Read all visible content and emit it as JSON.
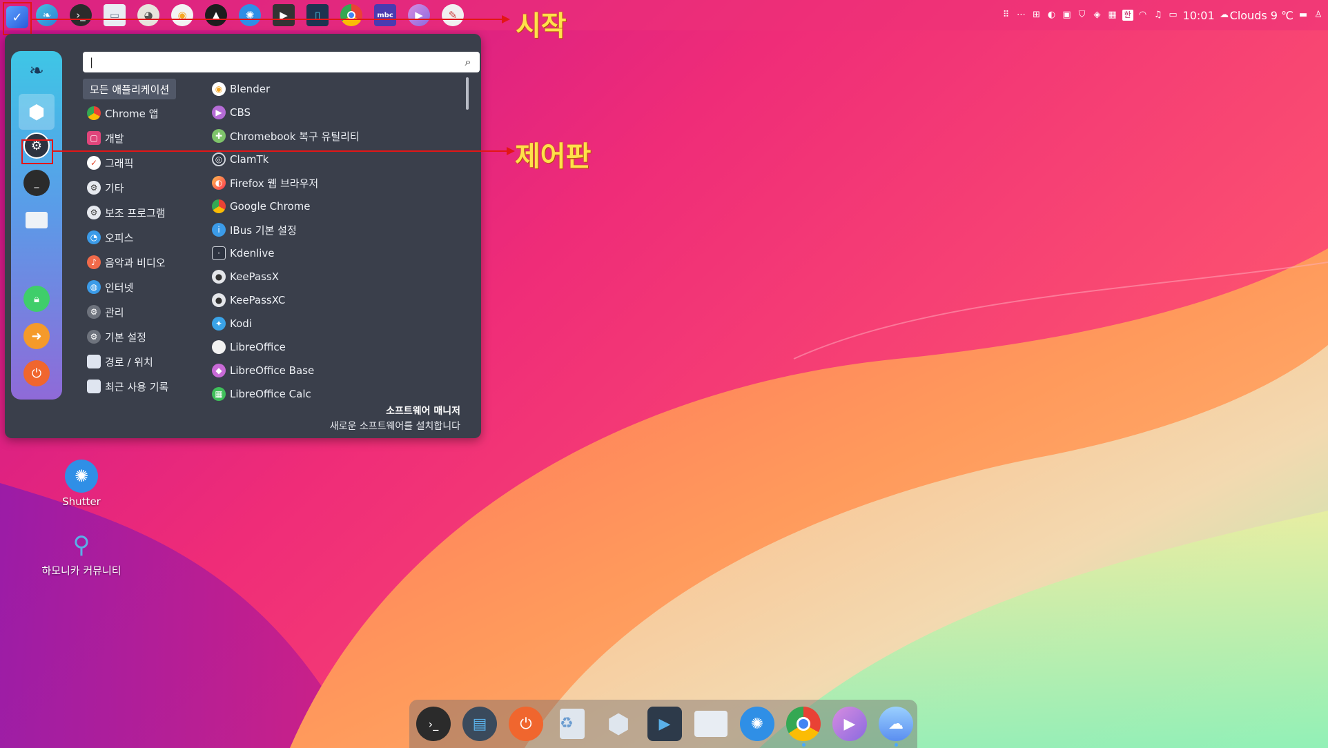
{
  "panel": {
    "launchers": [
      {
        "name": "start-menu",
        "icon": "start-icon"
      },
      {
        "name": "hamonikr-browser",
        "icon": "hamonikr-icon"
      },
      {
        "name": "terminal",
        "icon": "terminal-icon"
      },
      {
        "name": "file-manager",
        "icon": "folder-icon"
      },
      {
        "name": "gimp",
        "icon": "gimp-icon"
      },
      {
        "name": "blender",
        "icon": "blender-icon"
      },
      {
        "name": "inkscape",
        "icon": "inkscape-icon"
      },
      {
        "name": "shutter",
        "icon": "shutter-icon"
      },
      {
        "name": "kdenlive",
        "icon": "kdenlive-icon"
      },
      {
        "name": "libreoffice-writer",
        "icon": "document-icon"
      },
      {
        "name": "google-chrome",
        "icon": "chrome-icon"
      },
      {
        "name": "mbc-radio",
        "icon": "mbc-icon"
      },
      {
        "name": "cbs-player",
        "icon": "play-icon"
      },
      {
        "name": "text-editor",
        "icon": "pencil-icon"
      }
    ],
    "tray": {
      "time": "10:01",
      "weather": "Clouds 9 ℃",
      "ime": "한"
    }
  },
  "annotations": {
    "start_label": "시작",
    "control_panel_label": "제어판"
  },
  "menu": {
    "search": {
      "value": "|",
      "placeholder": ""
    },
    "sidebar": [
      {
        "name": "hamonikr",
        "icon": "hamonikr-icon"
      },
      {
        "name": "software-manager",
        "icon": "package-icon"
      },
      {
        "name": "control-panel",
        "icon": "settings-icon"
      },
      {
        "name": "terminal",
        "icon": "terminal-icon"
      },
      {
        "name": "files",
        "icon": "folder-icon"
      },
      {
        "name": "lock-screen",
        "icon": "lock-icon"
      },
      {
        "name": "logout",
        "icon": "logout-icon"
      },
      {
        "name": "shutdown",
        "icon": "power-icon"
      }
    ],
    "categories": [
      {
        "label": "모든 애플리케이션",
        "icon": "none",
        "color": ""
      },
      {
        "label": "Chrome 앱",
        "icon": "chrome-icon",
        "color": "#e94235"
      },
      {
        "label": "개발",
        "icon": "code-icon",
        "color": "#e0457b"
      },
      {
        "label": "그래픽",
        "icon": "graphics-icon",
        "color": "#ffffff"
      },
      {
        "label": "기타",
        "icon": "gear-icon",
        "color": "#d0d4dc"
      },
      {
        "label": "보조 프로그램",
        "icon": "gear-icon",
        "color": "#d0d4dc"
      },
      {
        "label": "오피스",
        "icon": "office-icon",
        "color": "#3b9be8"
      },
      {
        "label": "음악과 비디오",
        "icon": "music-icon",
        "color": "#f06a4a"
      },
      {
        "label": "인터넷",
        "icon": "globe-icon",
        "color": "#3b9be8"
      },
      {
        "label": "관리",
        "icon": "admin-icon",
        "color": "#8a8f99"
      },
      {
        "label": "기본 설정",
        "icon": "preferences-icon",
        "color": "#8a8f99"
      },
      {
        "label": "경로 / 위치",
        "icon": "folder-icon",
        "color": "#dfe5f0"
      },
      {
        "label": "최근 사용 기록",
        "icon": "recent-folder-icon",
        "color": "#dfe5f0"
      }
    ],
    "apps": [
      {
        "label": "Blender",
        "icon": "blender-icon",
        "color": "#f5a623"
      },
      {
        "label": "CBS",
        "icon": "play-icon",
        "color": "#b56cd6"
      },
      {
        "label": "Chromebook 복구 유틸리티",
        "icon": "wrench-icon",
        "color": "#7ec46a"
      },
      {
        "label": "ClamTk",
        "icon": "clamtk-icon",
        "color": "#cfd3da"
      },
      {
        "label": "Firefox 웹 브라우저",
        "icon": "firefox-icon",
        "color": "#ff7139"
      },
      {
        "label": "Google Chrome",
        "icon": "chrome-icon",
        "color": "#e94235"
      },
      {
        "label": "IBus 기본 설정",
        "icon": "info-icon",
        "color": "#3b9be8"
      },
      {
        "label": "Kdenlive",
        "icon": "kdenlive-icon",
        "color": "#cfd3da"
      },
      {
        "label": "KeePassX",
        "icon": "keepass-icon",
        "color": "#dfe2e8"
      },
      {
        "label": "KeePassXC",
        "icon": "keepass-icon",
        "color": "#dfe2e8"
      },
      {
        "label": "Kodi",
        "icon": "kodi-icon",
        "color": "#3aa3e8"
      },
      {
        "label": "LibreOffice",
        "icon": "libreoffice-icon",
        "color": "#f2f2f2"
      },
      {
        "label": "LibreOffice Base",
        "icon": "lo-base-icon",
        "color": "#c86ad6"
      },
      {
        "label": "LibreOffice Calc",
        "icon": "lo-calc-icon",
        "color": "#3fbf5a"
      }
    ],
    "footer": {
      "title": "소프트웨어 매니저",
      "description": "새로운 소프트웨어를 설치합니다"
    }
  },
  "desktop": {
    "icons": [
      {
        "label": "Shutter",
        "icon": "shutter-icon"
      },
      {
        "label": "하모니카 커뮤니티",
        "icon": "hamonikr-community-icon"
      }
    ]
  },
  "dock": {
    "items": [
      {
        "name": "terminal",
        "icon": "terminal-icon"
      },
      {
        "name": "screenshot",
        "icon": "screen-icon"
      },
      {
        "name": "power",
        "icon": "power-icon"
      },
      {
        "name": "trash",
        "icon": "trash-icon"
      },
      {
        "name": "software-manager",
        "icon": "package-icon"
      },
      {
        "name": "screen-recorder",
        "icon": "recorder-icon"
      },
      {
        "name": "files",
        "icon": "folder-icon"
      },
      {
        "name": "shutter",
        "icon": "shutter-icon"
      },
      {
        "name": "google-chrome",
        "icon": "chrome-icon"
      },
      {
        "name": "cbs-player",
        "icon": "play-icon"
      },
      {
        "name": "weather",
        "icon": "weather-icon"
      }
    ]
  }
}
